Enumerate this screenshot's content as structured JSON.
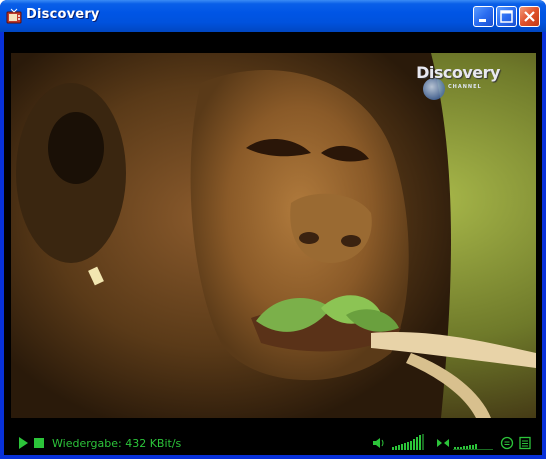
{
  "window": {
    "title": "Discovery"
  },
  "video": {
    "channel_logo_text": "Discovery",
    "channel_logo_subtext": "CHANNEL"
  },
  "status_bar": {
    "playback_status": "Wiedergabe: 432 KBit/s"
  },
  "colors": {
    "titlebar_blue": "#0055e5",
    "status_green": "#2cc43a",
    "close_red": "#e0502a"
  },
  "icons": [
    "app-icon",
    "minimize-icon",
    "maximize-icon",
    "close-icon",
    "play-icon",
    "stop-icon",
    "speaker-icon",
    "volume-meter-icon",
    "balance-icon",
    "equalizer-icon",
    "playlist-icon"
  ]
}
